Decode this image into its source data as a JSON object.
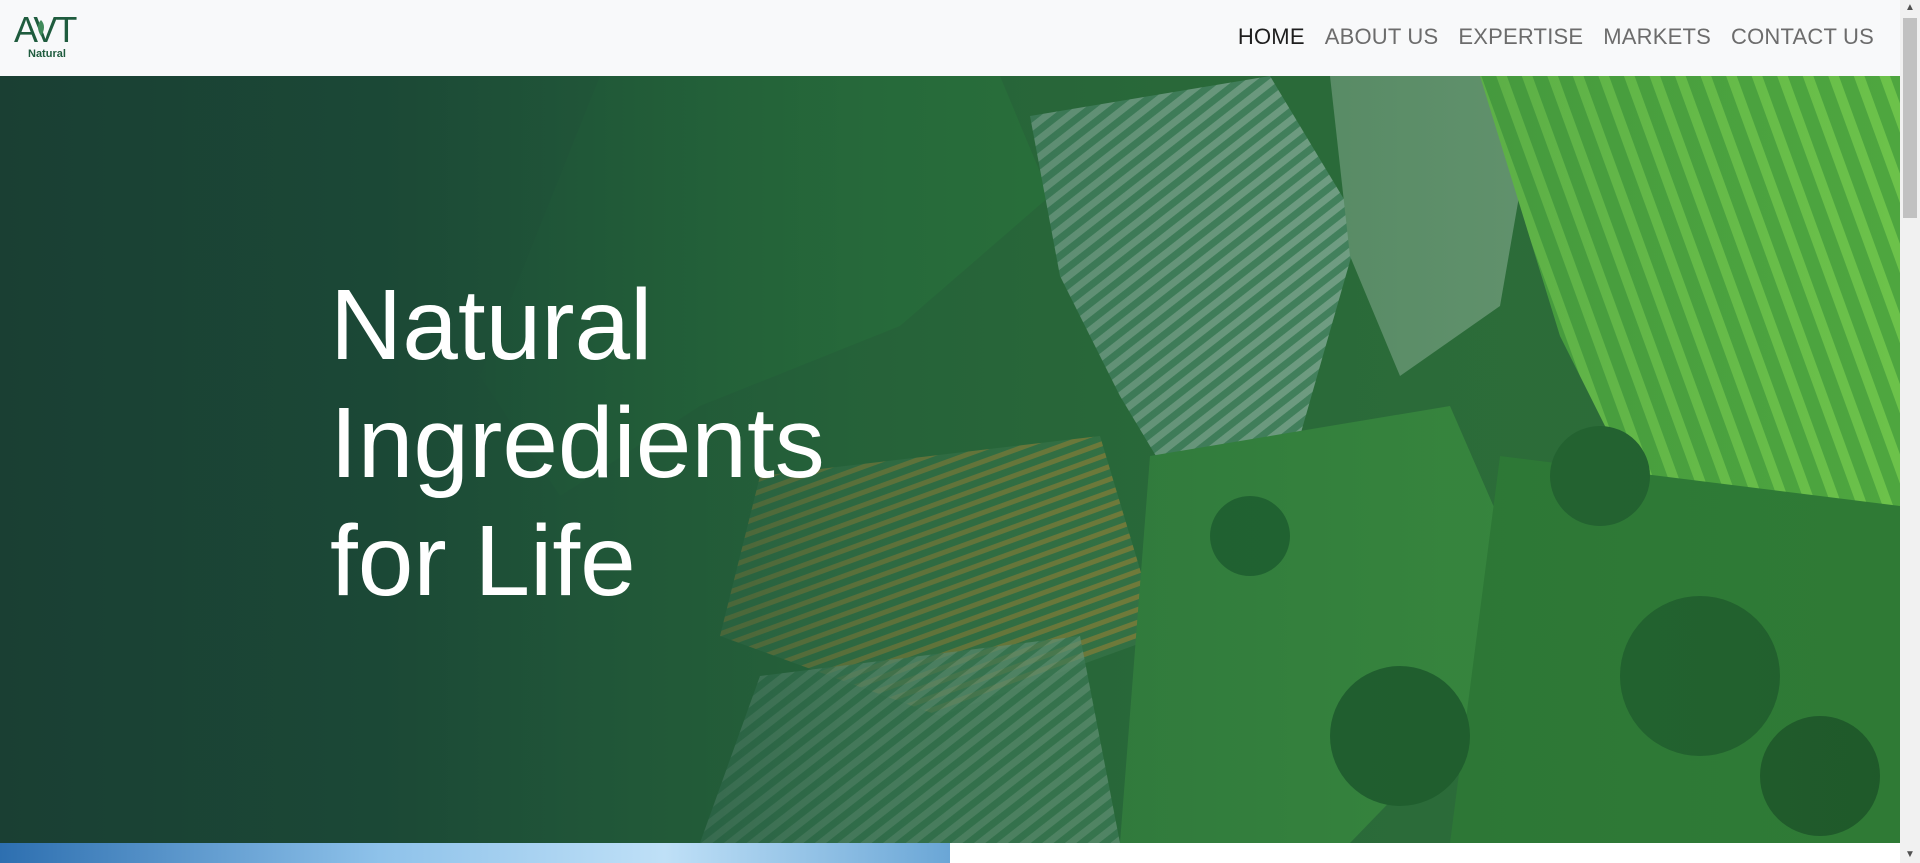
{
  "brand": {
    "logo_text": "AVT",
    "logo_sub": "Natural"
  },
  "nav": {
    "items": [
      {
        "label": "HOME",
        "active": true
      },
      {
        "label": "ABOUT US",
        "active": false
      },
      {
        "label": "EXPERTISE",
        "active": false
      },
      {
        "label": "MARKETS",
        "active": false
      },
      {
        "label": "CONTACT US",
        "active": false
      }
    ]
  },
  "hero": {
    "title_line1": "Natural",
    "title_line2": "Ingredients",
    "title_line3": "for Life"
  },
  "colors": {
    "brand_green": "#1f5c3e",
    "hero_dark": "#1a3f33",
    "nav_bg": "#f8f9fa"
  },
  "icons": {
    "scroll_up": "▲",
    "scroll_down": "▼"
  }
}
